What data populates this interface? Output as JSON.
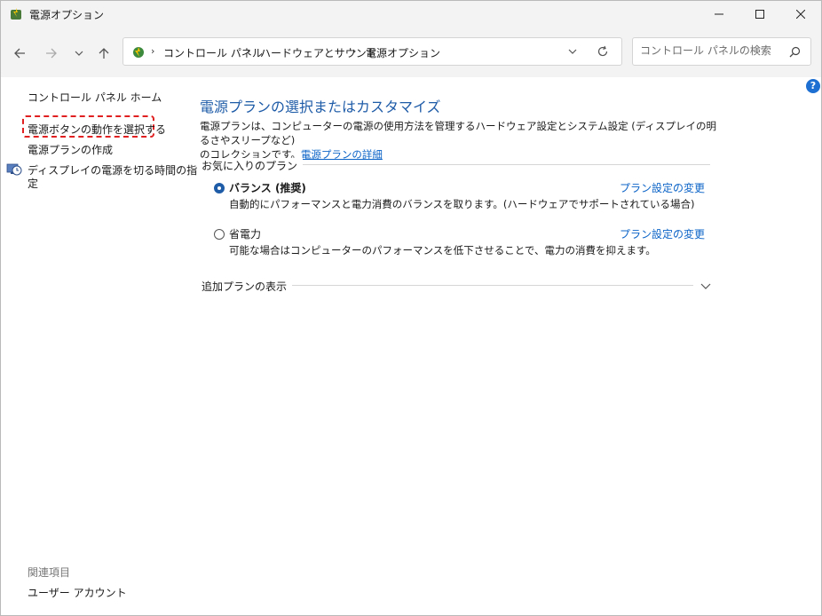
{
  "window": {
    "title": "電源オプション"
  },
  "nav": {
    "breadcrumb": [
      "コントロール パネル",
      "ハードウェアとサウンド",
      "電源オプション"
    ],
    "search_placeholder": "コントロール パネルの検索"
  },
  "sidebar": {
    "home": "コントロール パネル ホーム",
    "items": [
      "電源ボタンの動作を選択する",
      "電源プランの作成",
      "ディスプレイの電源を切る時間の指",
      "定"
    ],
    "related_header": "関連項目",
    "related_items": [
      "ユーザー アカウント"
    ]
  },
  "main": {
    "title": "電源プランの選択またはカスタマイズ",
    "description_line1": "電源プランは、コンピューターの電源の使用方法を管理するハードウェア設定とシステム設定 (ディスプレイの明るさやスリープなど)",
    "description_line2": "のコレクションです。",
    "description_link": "電源プランの詳細",
    "favorites_label": "お気に入りのプラン",
    "plans": [
      {
        "name": "バランス (推奨)",
        "description": "自動的にパフォーマンスと電力消費のバランスを取ります。(ハードウェアでサポートされている場合)",
        "link": "プラン設定の変更",
        "selected": true
      },
      {
        "name": "省電力",
        "description": "可能な場合はコンピューターのパフォーマンスを低下させることで、電力の消費を抑えます。",
        "link": "プラン設定の変更",
        "selected": false
      }
    ],
    "more_plans_label": "追加プランの表示"
  },
  "icons": {
    "app": "power-options-icon",
    "back": "arrow-left-icon",
    "forward": "arrow-right-icon",
    "recent": "chevron-down-icon",
    "up": "arrow-up-icon",
    "refresh": "refresh-icon",
    "search": "search-icon",
    "help": "help-icon",
    "display_timer": "display-clock-icon"
  },
  "colors": {
    "accent": "#1f5ca8",
    "link": "#0b63c7",
    "highlight": "#e02020"
  }
}
